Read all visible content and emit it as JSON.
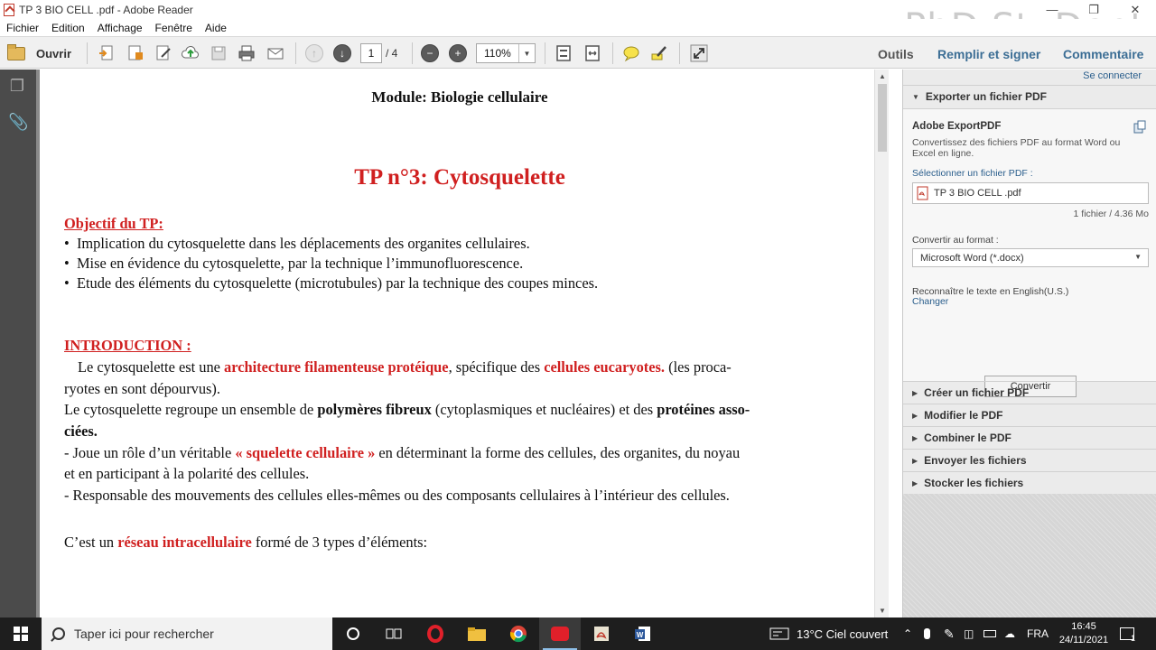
{
  "window": {
    "title": "TP 3 BIO CELL .pdf - Adobe Reader",
    "watermark": "PhD StuDent"
  },
  "menu": [
    "Fichier",
    "Edition",
    "Affichage",
    "Fenêtre",
    "Aide"
  ],
  "toolbar": {
    "open_label": "Ouvrir",
    "page_current": "1",
    "page_total": "/ 4",
    "zoom": "110%",
    "tools": "Outils",
    "fill_sign": "Remplir et signer",
    "comment": "Commentaire"
  },
  "document": {
    "module": "Module: Biologie cellulaire",
    "title": "TP n°3: Cytosquelette",
    "objective_heading": "Objectif du TP:",
    "objectives": [
      "Implication du cytosquelette dans les déplacements des organites cellulaires.",
      "Mise en évidence du cytosquelette, par la technique l’immunofluorescence.",
      "Etude des éléments du cytosquelette (microtubules) par la technique des coupes minces."
    ],
    "intro_heading": "INTRODUCTION :",
    "p1": {
      "a": "Le cytosquelette est une ",
      "b": "architecture filamenteuse protéique",
      "c": ", spécifique des ",
      "d": "cellules eucaryotes.",
      "e": " (les proca-",
      "f": "ryotes en sont dépourvus)."
    },
    "p2": {
      "a": "Le cytosquelette regroupe un ensemble de ",
      "b": "polymères fibreux",
      "c": " (cytoplasmiques et nucléaires) et des ",
      "d": "protéines asso-",
      "e": "ciées."
    },
    "p3": {
      "a": "- Joue un rôle d’un véritable ",
      "b": "« squelette cellulaire »",
      "c": " en déterminant la forme des cellules, des organites, du noyau",
      "d": "et en participant à la polarité des cellules."
    },
    "p4": "- Responsable des mouvements des cellules elles-mêmes ou des composants cellulaires à l’intérieur des cellules.",
    "p5": {
      "a": "C’est un ",
      "b": "réseau intracellulaire",
      "c": " formé de 3 types d’éléments:"
    }
  },
  "panel": {
    "connect": "Se connecter",
    "export_header": "Exporter un fichier PDF",
    "export_title": "Adobe ExportPDF",
    "export_desc_1": "Convertissez des fichiers PDF au format Word ou",
    "export_desc_2": "Excel en ligne.",
    "select_label": "Sélectionner un fichier PDF :",
    "file_name": "TP 3 BIO CELL .pdf",
    "file_info": "1 fichier / 4.36 Mo",
    "convert_label": "Convertir au format :",
    "format_value": "Microsoft Word (*.docx)",
    "ocr_text": "Reconnaître le texte en English(U.S.)",
    "change": "Changer",
    "convert_button": "Convertir",
    "sections": [
      "Créer un fichier PDF",
      "Modifier le PDF",
      "Combiner le PDF",
      "Envoyer les fichiers",
      "Stocker les fichiers"
    ]
  },
  "taskbar": {
    "search_placeholder": "Taper ici pour rechercher",
    "weather": "13°C  Ciel couvert",
    "lang": "FRA",
    "time": "16:45",
    "date": "24/11/2021",
    "notifications": "1"
  }
}
